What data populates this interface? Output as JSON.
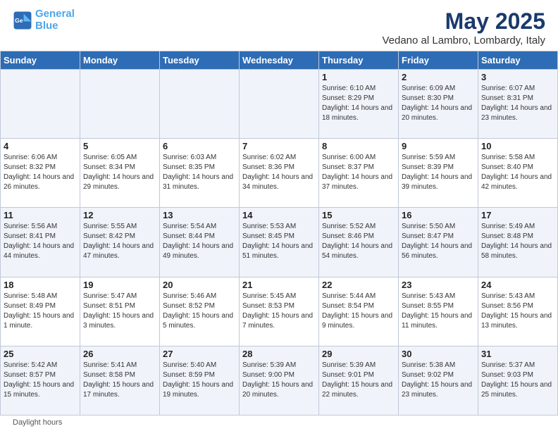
{
  "header": {
    "logo_line1": "General",
    "logo_line2": "Blue",
    "main_title": "May 2025",
    "subtitle": "Vedano al Lambro, Lombardy, Italy"
  },
  "days_of_week": [
    "Sunday",
    "Monday",
    "Tuesday",
    "Wednesday",
    "Thursday",
    "Friday",
    "Saturday"
  ],
  "weeks": [
    [
      {
        "num": "",
        "detail": ""
      },
      {
        "num": "",
        "detail": ""
      },
      {
        "num": "",
        "detail": ""
      },
      {
        "num": "",
        "detail": ""
      },
      {
        "num": "1",
        "detail": "Sunrise: 6:10 AM\nSunset: 8:29 PM\nDaylight: 14 hours and 18 minutes."
      },
      {
        "num": "2",
        "detail": "Sunrise: 6:09 AM\nSunset: 8:30 PM\nDaylight: 14 hours and 20 minutes."
      },
      {
        "num": "3",
        "detail": "Sunrise: 6:07 AM\nSunset: 8:31 PM\nDaylight: 14 hours and 23 minutes."
      }
    ],
    [
      {
        "num": "4",
        "detail": "Sunrise: 6:06 AM\nSunset: 8:32 PM\nDaylight: 14 hours and 26 minutes."
      },
      {
        "num": "5",
        "detail": "Sunrise: 6:05 AM\nSunset: 8:34 PM\nDaylight: 14 hours and 29 minutes."
      },
      {
        "num": "6",
        "detail": "Sunrise: 6:03 AM\nSunset: 8:35 PM\nDaylight: 14 hours and 31 minutes."
      },
      {
        "num": "7",
        "detail": "Sunrise: 6:02 AM\nSunset: 8:36 PM\nDaylight: 14 hours and 34 minutes."
      },
      {
        "num": "8",
        "detail": "Sunrise: 6:00 AM\nSunset: 8:37 PM\nDaylight: 14 hours and 37 minutes."
      },
      {
        "num": "9",
        "detail": "Sunrise: 5:59 AM\nSunset: 8:39 PM\nDaylight: 14 hours and 39 minutes."
      },
      {
        "num": "10",
        "detail": "Sunrise: 5:58 AM\nSunset: 8:40 PM\nDaylight: 14 hours and 42 minutes."
      }
    ],
    [
      {
        "num": "11",
        "detail": "Sunrise: 5:56 AM\nSunset: 8:41 PM\nDaylight: 14 hours and 44 minutes."
      },
      {
        "num": "12",
        "detail": "Sunrise: 5:55 AM\nSunset: 8:42 PM\nDaylight: 14 hours and 47 minutes."
      },
      {
        "num": "13",
        "detail": "Sunrise: 5:54 AM\nSunset: 8:44 PM\nDaylight: 14 hours and 49 minutes."
      },
      {
        "num": "14",
        "detail": "Sunrise: 5:53 AM\nSunset: 8:45 PM\nDaylight: 14 hours and 51 minutes."
      },
      {
        "num": "15",
        "detail": "Sunrise: 5:52 AM\nSunset: 8:46 PM\nDaylight: 14 hours and 54 minutes."
      },
      {
        "num": "16",
        "detail": "Sunrise: 5:50 AM\nSunset: 8:47 PM\nDaylight: 14 hours and 56 minutes."
      },
      {
        "num": "17",
        "detail": "Sunrise: 5:49 AM\nSunset: 8:48 PM\nDaylight: 14 hours and 58 minutes."
      }
    ],
    [
      {
        "num": "18",
        "detail": "Sunrise: 5:48 AM\nSunset: 8:49 PM\nDaylight: 15 hours and 1 minute."
      },
      {
        "num": "19",
        "detail": "Sunrise: 5:47 AM\nSunset: 8:51 PM\nDaylight: 15 hours and 3 minutes."
      },
      {
        "num": "20",
        "detail": "Sunrise: 5:46 AM\nSunset: 8:52 PM\nDaylight: 15 hours and 5 minutes."
      },
      {
        "num": "21",
        "detail": "Sunrise: 5:45 AM\nSunset: 8:53 PM\nDaylight: 15 hours and 7 minutes."
      },
      {
        "num": "22",
        "detail": "Sunrise: 5:44 AM\nSunset: 8:54 PM\nDaylight: 15 hours and 9 minutes."
      },
      {
        "num": "23",
        "detail": "Sunrise: 5:43 AM\nSunset: 8:55 PM\nDaylight: 15 hours and 11 minutes."
      },
      {
        "num": "24",
        "detail": "Sunrise: 5:43 AM\nSunset: 8:56 PM\nDaylight: 15 hours and 13 minutes."
      }
    ],
    [
      {
        "num": "25",
        "detail": "Sunrise: 5:42 AM\nSunset: 8:57 PM\nDaylight: 15 hours and 15 minutes."
      },
      {
        "num": "26",
        "detail": "Sunrise: 5:41 AM\nSunset: 8:58 PM\nDaylight: 15 hours and 17 minutes."
      },
      {
        "num": "27",
        "detail": "Sunrise: 5:40 AM\nSunset: 8:59 PM\nDaylight: 15 hours and 19 minutes."
      },
      {
        "num": "28",
        "detail": "Sunrise: 5:39 AM\nSunset: 9:00 PM\nDaylight: 15 hours and 20 minutes."
      },
      {
        "num": "29",
        "detail": "Sunrise: 5:39 AM\nSunset: 9:01 PM\nDaylight: 15 hours and 22 minutes."
      },
      {
        "num": "30",
        "detail": "Sunrise: 5:38 AM\nSunset: 9:02 PM\nDaylight: 15 hours and 23 minutes."
      },
      {
        "num": "31",
        "detail": "Sunrise: 5:37 AM\nSunset: 9:03 PM\nDaylight: 15 hours and 25 minutes."
      }
    ]
  ],
  "footer": {
    "note": "Daylight hours"
  }
}
